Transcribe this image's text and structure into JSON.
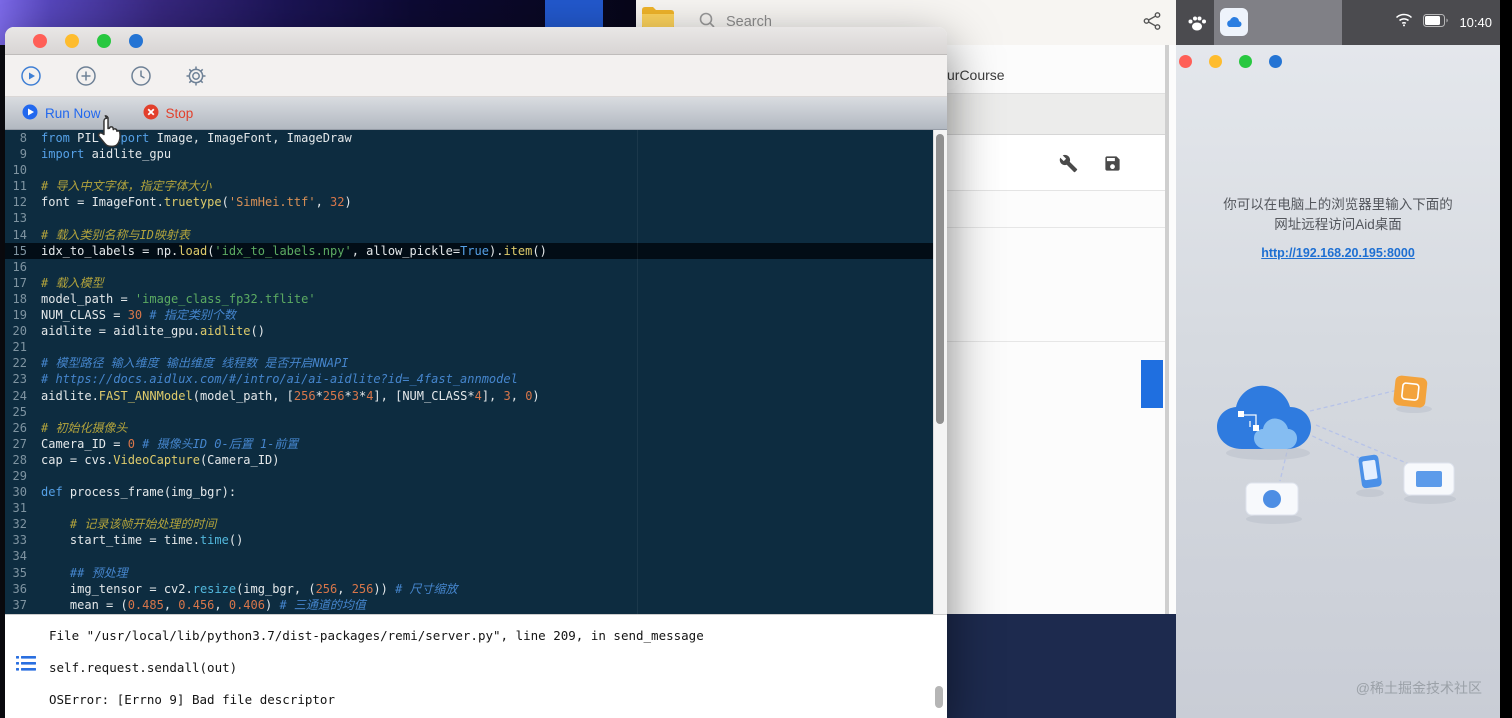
{
  "browser": {
    "search_placeholder": "Search",
    "page_title_fragment": "urCourse"
  },
  "ide": {
    "runbar": {
      "run_label": "Run Now",
      "stop_label": "Stop"
    },
    "code": {
      "lines": [
        {
          "n": "8",
          "t": [
            [
              "kw",
              "from "
            ],
            [
              "t",
              "PIL "
            ],
            [
              "kw",
              "import "
            ],
            [
              "t",
              "Image, ImageFont, ImageDraw"
            ]
          ]
        },
        {
          "n": "9",
          "t": [
            [
              "kw",
              "import "
            ],
            [
              "t",
              "aidlite_gpu"
            ]
          ]
        },
        {
          "n": "10",
          "t": []
        },
        {
          "n": "11",
          "t": [
            [
              "cy",
              "# 导入中文字体，指定字体大小"
            ]
          ]
        },
        {
          "n": "12",
          "t": [
            [
              "t",
              "font = ImageFont."
            ],
            [
              "fn",
              "truetype"
            ],
            [
              "t",
              "("
            ],
            [
              "so",
              "'SimHei.ttf'"
            ],
            [
              "t",
              ", "
            ],
            [
              "num",
              "32"
            ],
            [
              "t",
              ")"
            ]
          ]
        },
        {
          "n": "13",
          "t": []
        },
        {
          "n": "14",
          "t": [
            [
              "cy",
              "# 载入类别名称与ID映射表"
            ]
          ]
        },
        {
          "n": "15",
          "hl": true,
          "t": [
            [
              "t",
              "idx_to_labels = np."
            ],
            [
              "fn",
              "load"
            ],
            [
              "t",
              "("
            ],
            [
              "sg",
              "'idx_to_labels.npy'"
            ],
            [
              "t",
              ", allow_pickle="
            ],
            [
              "kw",
              "True"
            ],
            [
              "t",
              ")."
            ],
            [
              "fn",
              "item"
            ],
            [
              "t",
              "()"
            ]
          ]
        },
        {
          "n": "16",
          "t": []
        },
        {
          "n": "17",
          "t": [
            [
              "cy",
              "# 载入模型"
            ]
          ]
        },
        {
          "n": "18",
          "t": [
            [
              "t",
              "model_path = "
            ],
            [
              "sg",
              "'image_class_fp32.tflite'"
            ]
          ]
        },
        {
          "n": "19",
          "t": [
            [
              "t",
              "NUM_CLASS = "
            ],
            [
              "num",
              "30"
            ],
            [
              "t",
              " "
            ],
            [
              "cb",
              "# 指定类别个数"
            ]
          ]
        },
        {
          "n": "20",
          "t": [
            [
              "t",
              "aidlite = aidlite_gpu."
            ],
            [
              "fn",
              "aidlite"
            ],
            [
              "t",
              "()"
            ]
          ]
        },
        {
          "n": "21",
          "t": []
        },
        {
          "n": "22",
          "t": [
            [
              "cb",
              "# 模型路径 输入维度 输出维度 线程数 是否开启NNAPI"
            ]
          ]
        },
        {
          "n": "23",
          "t": [
            [
              "cb",
              "# https://docs.aidlux.com/#/intro/ai/ai-aidlite?id=_4fast_annmodel"
            ]
          ]
        },
        {
          "n": "24",
          "t": [
            [
              "t",
              "aidlite."
            ],
            [
              "fn",
              "FAST_ANNModel"
            ],
            [
              "t",
              "(model_path, ["
            ],
            [
              "num",
              "256"
            ],
            [
              "t",
              "*"
            ],
            [
              "num",
              "256"
            ],
            [
              "t",
              "*"
            ],
            [
              "num",
              "3"
            ],
            [
              "t",
              "*"
            ],
            [
              "num",
              "4"
            ],
            [
              "t",
              "], [NUM_CLASS*"
            ],
            [
              "num",
              "4"
            ],
            [
              "t",
              "], "
            ],
            [
              "num",
              "3"
            ],
            [
              "t",
              ", "
            ],
            [
              "num",
              "0"
            ],
            [
              "t",
              ")"
            ]
          ]
        },
        {
          "n": "25",
          "t": []
        },
        {
          "n": "26",
          "t": [
            [
              "cy",
              "# 初始化摄像头"
            ]
          ]
        },
        {
          "n": "27",
          "t": [
            [
              "t",
              "Camera_ID = "
            ],
            [
              "num",
              "0"
            ],
            [
              "t",
              " "
            ],
            [
              "cb",
              "# 摄像头ID 0-后置 1-前置"
            ]
          ]
        },
        {
          "n": "28",
          "t": [
            [
              "t",
              "cap = cvs."
            ],
            [
              "fn",
              "VideoCapture"
            ],
            [
              "t",
              "(Camera_ID)"
            ]
          ]
        },
        {
          "n": "29",
          "t": []
        },
        {
          "n": "30",
          "t": [
            [
              "kw",
              "def "
            ],
            [
              "t",
              "process_frame(img_bgr):"
            ]
          ]
        },
        {
          "n": "31",
          "t": []
        },
        {
          "n": "32",
          "t": [
            [
              "t",
              "    "
            ],
            [
              "cy",
              "# 记录该帧开始处理的时间"
            ]
          ]
        },
        {
          "n": "33",
          "t": [
            [
              "t",
              "    start_time = time."
            ],
            [
              "fnb",
              "time"
            ],
            [
              "t",
              "()"
            ]
          ]
        },
        {
          "n": "34",
          "t": []
        },
        {
          "n": "35",
          "t": [
            [
              "t",
              "    "
            ],
            [
              "cb",
              "## 预处理"
            ]
          ]
        },
        {
          "n": "36",
          "t": [
            [
              "t",
              "    img_tensor = cv2."
            ],
            [
              "fnb",
              "resize"
            ],
            [
              "t",
              "(img_bgr, ("
            ],
            [
              "num",
              "256"
            ],
            [
              "t",
              ", "
            ],
            [
              "num",
              "256"
            ],
            [
              "t",
              ")) "
            ],
            [
              "cb",
              "# 尺寸缩放"
            ]
          ]
        },
        {
          "n": "37",
          "t": [
            [
              "t",
              "    mean = ("
            ],
            [
              "num",
              "0.485"
            ],
            [
              "t",
              ", "
            ],
            [
              "num",
              "0.456"
            ],
            [
              "t",
              ", "
            ],
            [
              "num",
              "0.406"
            ],
            [
              "t",
              ") "
            ],
            [
              "cb",
              "# 三通道的均值"
            ]
          ]
        }
      ]
    },
    "console": {
      "lines": [
        "File \"/usr/local/lib/python3.7/dist-packages/remi/server.py\", line 209, in send_message",
        "self.request.sendall(out)",
        "OSError: [Errno 9] Bad file descriptor"
      ]
    }
  },
  "phone": {
    "status_time": "10:40",
    "instruction_line1": "你可以在电脑上的浏览器里输入下面的",
    "instruction_line2": "网址远程访问Aid桌面",
    "remote_url": "http://192.168.20.195:8000",
    "watermark": "@稀土掘金技术社区"
  },
  "colors": {
    "accent_blue": "#2268ee",
    "stop_red": "#e2402c",
    "link_blue": "#1e6fd2",
    "editor_bg": "#0d2c40"
  }
}
